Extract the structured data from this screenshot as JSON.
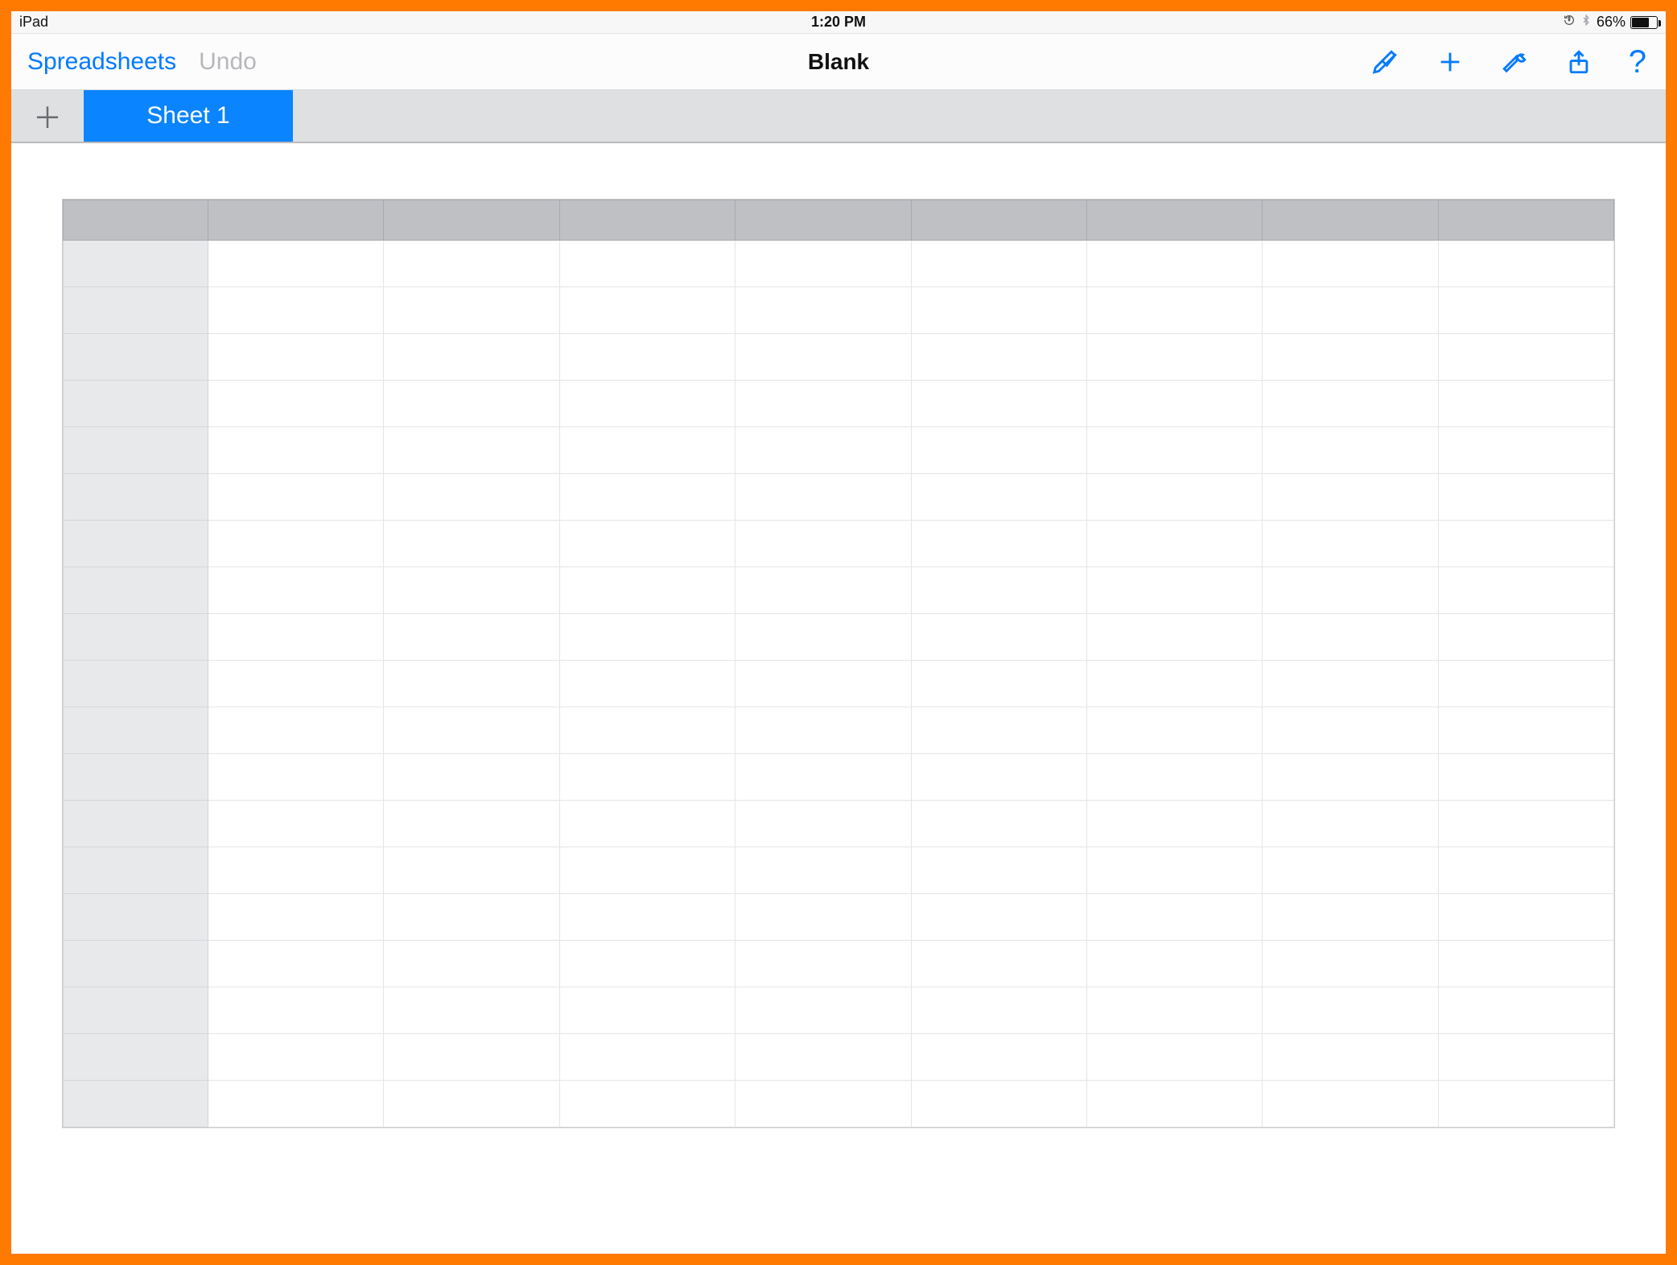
{
  "status": {
    "device": "iPad",
    "time": "1:20 PM",
    "battery_pct": "66%",
    "lock_icon": "⊕",
    "bluetooth_icon": "✳"
  },
  "toolbar": {
    "back_label": "Spreadsheets",
    "undo_label": "Undo",
    "doc_title": "Blank",
    "help_label": "?"
  },
  "tabs": {
    "add_glyph": "＋",
    "active_label": "Sheet 1"
  },
  "grid": {
    "columns": 9,
    "rows": 19
  },
  "colors": {
    "accent": "#007aff",
    "frame": "#ff7a00",
    "tab_active": "#0a84ff"
  }
}
